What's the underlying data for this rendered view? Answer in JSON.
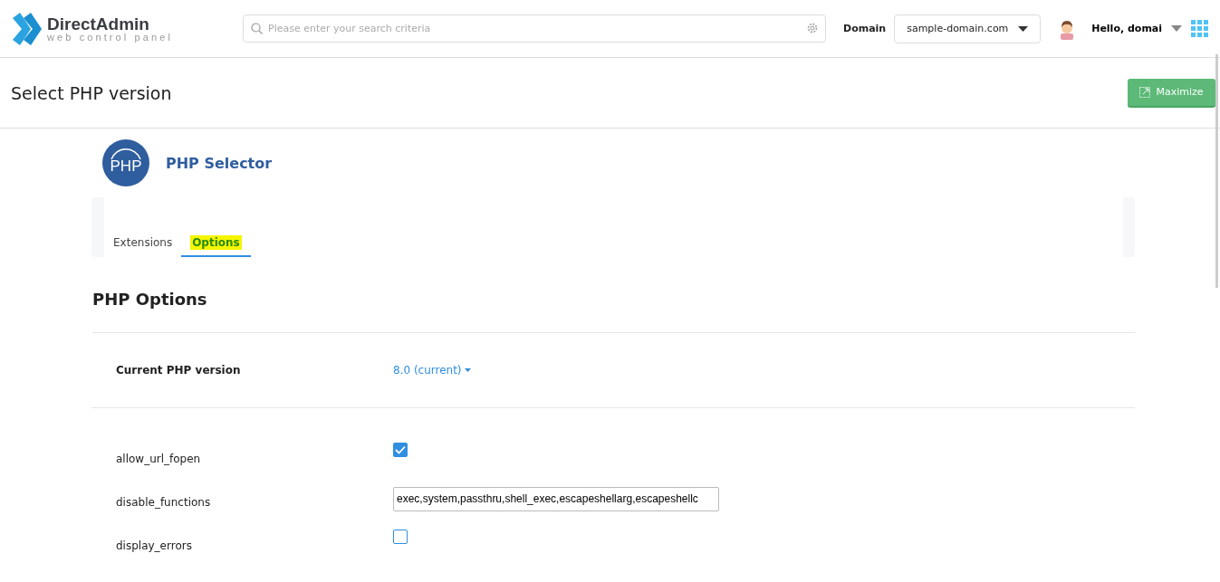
{
  "header": {
    "logo_title": "DirectAdmin",
    "logo_subtitle": "web control panel",
    "search": {
      "placeholder": "Please enter your search criteria"
    },
    "domain_label": "Domain",
    "domain_value": "sample-domain.com",
    "greeting": "Hello, domai"
  },
  "page": {
    "title": "Select PHP version",
    "maximize_button": "Maximize"
  },
  "plugin": {
    "title": "PHP Selector",
    "icon_text": "PHP"
  },
  "tabs": [
    {
      "label": "Extensions",
      "selected": false,
      "highlighted": false
    },
    {
      "label": "Options",
      "selected": true,
      "highlighted": true
    }
  ],
  "section_title": "PHP Options",
  "version": {
    "label": "Current PHP version",
    "value": "8.0 (current)"
  },
  "options": [
    {
      "kind": "checkbox",
      "name": "allow_url_fopen",
      "checked": true
    },
    {
      "kind": "text",
      "name": "disable_functions",
      "value": "exec,system,passthru,shell_exec,escapeshellarg,escapeshellc"
    },
    {
      "kind": "checkbox",
      "name": "display_errors",
      "checked": false
    }
  ]
}
